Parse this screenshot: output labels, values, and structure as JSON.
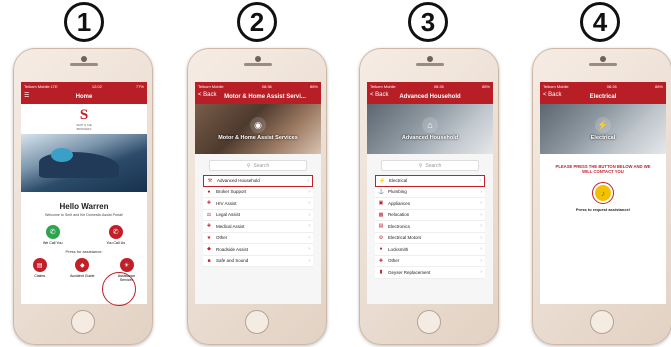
{
  "steps": [
    "1",
    "2",
    "3",
    "4"
  ],
  "phone1": {
    "status_left": "Telkom Mobile LTE",
    "status_time": "12:02",
    "status_right": "77%",
    "title": "Home",
    "logo_letter": "S",
    "logo_line1": "SMIT & KIE",
    "logo_line2": "BROKERS",
    "greeting": "Hello Warren",
    "welcome": "Welcome to Smit and Kie Domestic Assist Portal!",
    "btn_call_me": "We Call You",
    "btn_you_call": "You Call Us",
    "press_text": "Press for assistance:",
    "btn_claims": "Claims",
    "btn_accident": "Accident Guide",
    "btn_assistance": "Assistance",
    "btn_assistance_sub": "Services"
  },
  "phone2": {
    "status_left": "Telkom Mobile",
    "status_time": "08:36",
    "status_right": "88%",
    "back": "< Back",
    "title": "Motor & Home Assist Servi...",
    "hero_title": "Motor & Home Assist Services",
    "search": "Search",
    "items": [
      "Advanced Household",
      "Broker Support",
      "HIV Assist",
      "Legal Assist",
      "Medical Assist",
      "Other",
      "Roadside Assist",
      "Safe and Sound"
    ]
  },
  "phone3": {
    "status_left": "Telkom Mobile",
    "status_time": "08:26",
    "status_right": "88%",
    "back": "< Back",
    "title": "Advanced Household",
    "hero_title": "Advanced Household",
    "search": "Search",
    "items": [
      "Electrical",
      "Plumbing",
      "Appliances",
      "Relocation",
      "Electronics",
      "Electrical Motors",
      "Locksmith",
      "Other",
      "Geyser Replacement"
    ]
  },
  "phone4": {
    "status_left": "Telkom Mobile",
    "status_time": "08:26",
    "status_right": "88%",
    "back": "< Back",
    "title": "Electrical",
    "hero_title": "Electrical",
    "instruction": "PLEASE PRESS THE BUTTON BELOW AND WE WILL CONTACT YOU",
    "press_label": "Press to request assistance!"
  },
  "colors": {
    "brand_red": "#b81e26",
    "highlight": "#c21f28",
    "bell": "#f2c200"
  }
}
